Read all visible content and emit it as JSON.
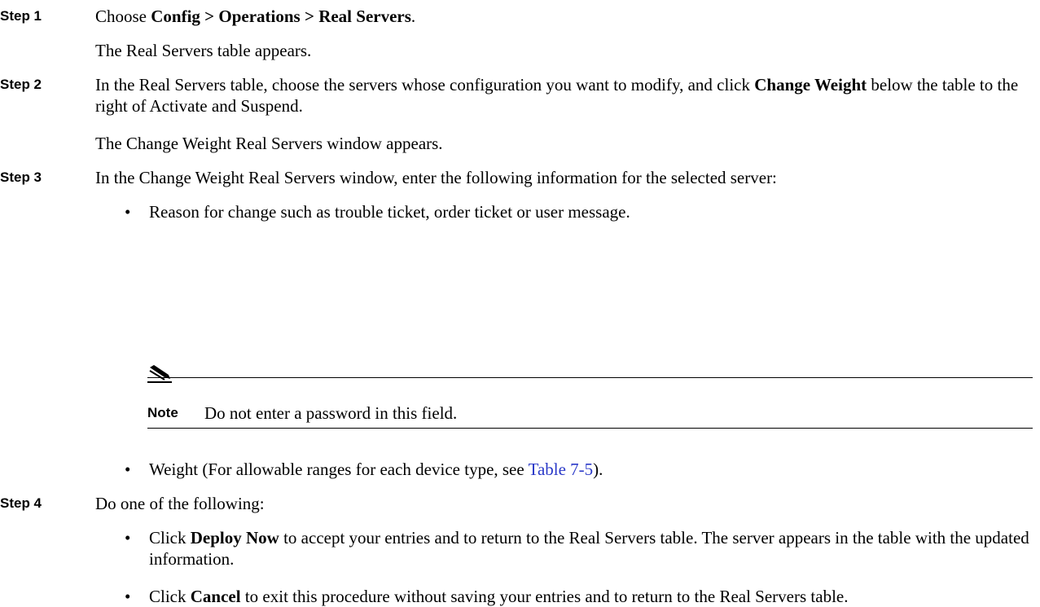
{
  "step1": {
    "label": "Step 1",
    "pre": "Choose ",
    "menu_path": "Config > Operations > Real Servers",
    "post": ".",
    "result": "The Real Servers table appears."
  },
  "step2": {
    "label": "Step 2",
    "pre": "In the Real Servers table, choose the servers whose configuration you want to modify, and click ",
    "button": "Change Weight",
    "post": " below the table to the right of Activate and Suspend.",
    "result": "The Change Weight Real Servers window appears."
  },
  "step3": {
    "label": "Step 3",
    "text": "In the Change Weight Real Servers window, enter the following information for the selected server:",
    "bullet1": "Reason for change such as trouble ticket, order ticket or user message.",
    "note_label": "Note",
    "note_text": "Do not enter a password in this field.",
    "bullet2_pre": "Weight (For allowable ranges for each device type, see ",
    "bullet2_link": "Table 7-5",
    "bullet2_post": ")."
  },
  "step4": {
    "label": "Step 4",
    "text": "Do one of the following:",
    "bullet1_pre": "Click ",
    "bullet1_button": "Deploy Now",
    "bullet1_post": " to accept your entries and to return to the Real Servers table. The server appears in the table with the updated information.",
    "bullet2_pre": "Click ",
    "bullet2_button": "Cancel",
    "bullet2_post": " to exit this procedure without saving your entries and to return to the Real Servers table."
  },
  "bullet_char": "•",
  "icons": {
    "note": "pencil-note-icon"
  },
  "colors": {
    "link": "#2a39c8"
  }
}
